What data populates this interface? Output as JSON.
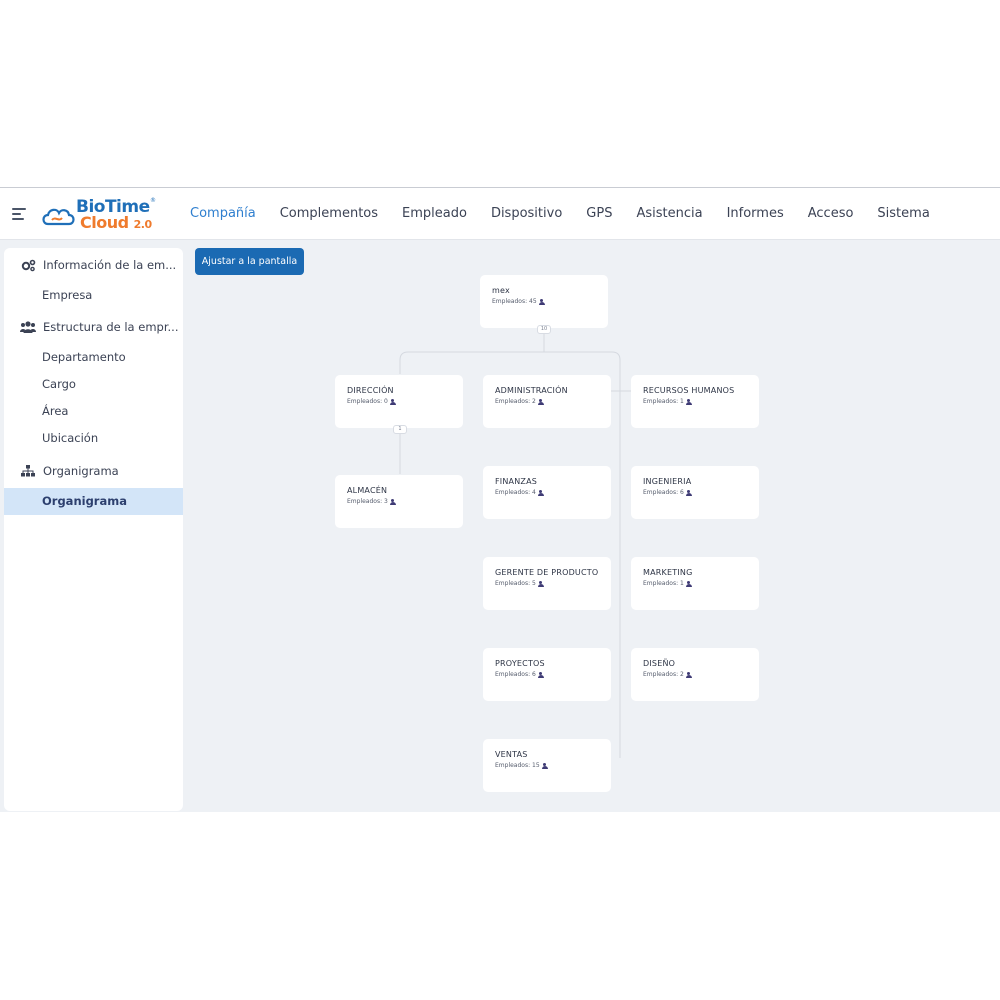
{
  "header": {
    "logo_top": "BioTime",
    "logo_bottom": "Cloud",
    "logo_version": "2.0",
    "logo_reg": "®",
    "nav": [
      {
        "label": "Compañía",
        "active": true
      },
      {
        "label": "Complementos"
      },
      {
        "label": "Empleado"
      },
      {
        "label": "Dispositivo"
      },
      {
        "label": "GPS"
      },
      {
        "label": "Asistencia"
      },
      {
        "label": "Informes"
      },
      {
        "label": "Acceso"
      },
      {
        "label": "Sistema"
      }
    ]
  },
  "sidebar": {
    "groups": [
      {
        "label": "Información de la em...",
        "icon": "gears-icon"
      },
      {
        "label": "Estructura de la empr...",
        "icon": "users-icon"
      },
      {
        "label": "Organigrama",
        "icon": "org-chart-icon"
      }
    ],
    "items": [
      {
        "label": "Empresa"
      },
      {
        "label": "Departamento"
      },
      {
        "label": "Cargo"
      },
      {
        "label": "Área"
      },
      {
        "label": "Ubicación"
      },
      {
        "label": "Organigrama",
        "active": true
      }
    ]
  },
  "toolbar": {
    "fit_label": "Ajustar a la pantalla"
  },
  "org": {
    "employees_label": "Empleados:",
    "root": {
      "name": "mex",
      "count": "45"
    },
    "root_toggle": "10",
    "direccion_toggle": "1",
    "departments": [
      {
        "name": "DIRECCIÓN",
        "count": "0"
      },
      {
        "name": "ALMACÉN",
        "count": "3"
      },
      {
        "name": "ADMINISTRACIÓN",
        "count": "2"
      },
      {
        "name": "FINANZAS",
        "count": "4"
      },
      {
        "name": "GERENTE DE PRODUCTO",
        "count": "5"
      },
      {
        "name": "PROYECTOS",
        "count": "6"
      },
      {
        "name": "VENTAS",
        "count": "15"
      },
      {
        "name": "RECURSOS HUMANOS",
        "count": "1"
      },
      {
        "name": "INGENIERIA",
        "count": "6"
      },
      {
        "name": "MARKETING",
        "count": "1"
      },
      {
        "name": "DISEÑO",
        "count": "2"
      }
    ]
  },
  "colors": {
    "accent": "#2f7fcf",
    "button": "#1b6ab3",
    "logo_blue": "#1f6fb8",
    "logo_orange": "#ef7b2d",
    "canvas": "#eef1f5"
  }
}
